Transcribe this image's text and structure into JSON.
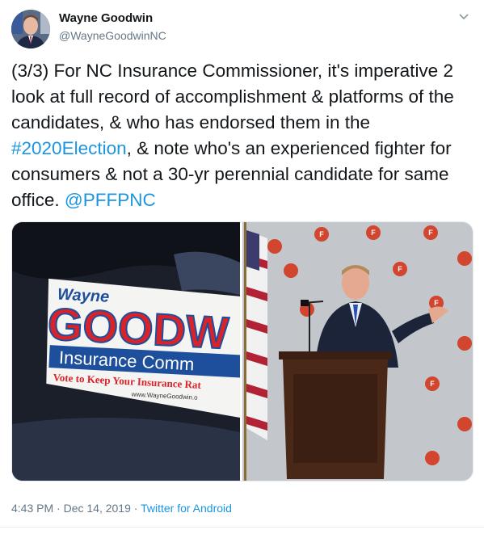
{
  "author": {
    "name": "Wayne Goodwin",
    "handle": "@WayneGoodwinNC"
  },
  "tweet": {
    "text_before": "(3/3) For NC Insurance Commissioner, it's imperative 2 look at full record of accomplishment & platforms of the candidates, & who has endorsed them in the ",
    "hashtag": "#2020Election",
    "text_middle": ", & note who's an experienced fighter for consumers & not a 30-yr perennial candidate for same office. ",
    "mention": "@PFFPNC"
  },
  "media": {
    "left_photo": {
      "sign_name_small": "Wayne",
      "sign_name_large": "GOODW",
      "sign_office": "Insurance Comm",
      "sign_slogan": "Vote to Keep Your Insurance Rat",
      "sign_url": "www.WayneGoodwin.o"
    },
    "right_photo": {
      "backdrop_emblem": "F"
    }
  },
  "meta": {
    "time": "4:43 PM",
    "separator": " · ",
    "date": "Dec 14, 2019",
    "separator2": " · ",
    "source": "Twitter for Android"
  },
  "icons": {
    "caret": "chevron-down-icon"
  },
  "colors": {
    "link": "#1b95e0",
    "sign_red": "#d8232a",
    "sign_blue": "#1d4f9c"
  }
}
